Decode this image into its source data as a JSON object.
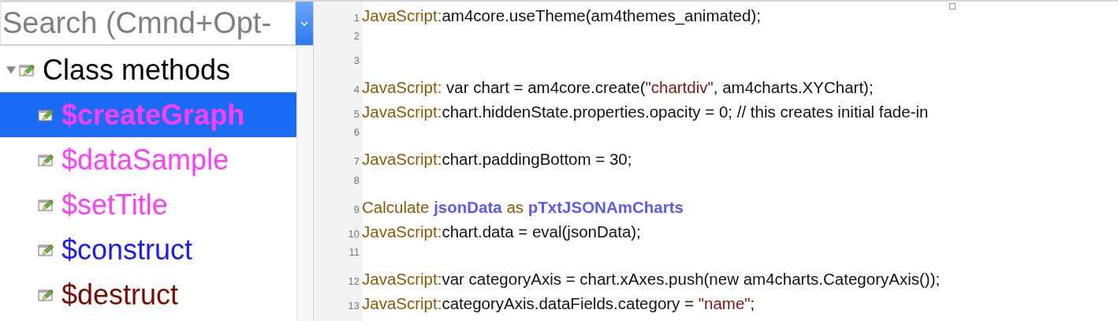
{
  "search": {
    "placeholder": "Search (Cmnd+Opt-"
  },
  "tree": [
    {
      "label": "Class methods",
      "expanded": true,
      "selected": false,
      "color": "#000000",
      "children": [
        {
          "label": "$createGraph",
          "selected": true,
          "color": "#ff3dfc"
        },
        {
          "label": "$dataSample",
          "selected": false,
          "color": "#ff3dfc"
        },
        {
          "label": "$setTitle",
          "selected": false,
          "color": "#ff3dfc"
        },
        {
          "label": "$construct",
          "selected": false,
          "color": "#1a1aff"
        },
        {
          "label": "$destruct",
          "selected": false,
          "color": "#7a0a00"
        }
      ]
    }
  ],
  "code_lines": [
    {
      "number": "1",
      "segments": [
        {
          "kind": "keyword",
          "text": "JavaScript:"
        },
        {
          "kind": "plain",
          "text": "am4core.useTheme(am4themes_animated);"
        }
      ]
    },
    {
      "number": "2"
    },
    {
      "number": "3"
    },
    {
      "number": "4",
      "segments": [
        {
          "kind": "keyword",
          "text": "JavaScript:"
        },
        {
          "kind": "plain",
          "text": " var chart = am4core.create("
        },
        {
          "kind": "string",
          "text": "\"chartdiv\""
        },
        {
          "kind": "plain",
          "text": ", am4charts.XYChart);"
        }
      ]
    },
    {
      "number": "5",
      "segments": [
        {
          "kind": "keyword",
          "text": "JavaScript:"
        },
        {
          "kind": "plain",
          "text": "chart.hiddenState.properties.opacity = 0; // this creates initial fade-in"
        }
      ]
    },
    {
      "number": "6"
    },
    {
      "number": "7",
      "segments": [
        {
          "kind": "keyword",
          "text": "JavaScript:"
        },
        {
          "kind": "plain",
          "text": "chart.paddingBottom = 30;"
        }
      ]
    },
    {
      "number": "8"
    },
    {
      "number": "9",
      "segments": [
        {
          "kind": "keyword",
          "text": "Calculate "
        },
        {
          "kind": "variable",
          "text": "jsonData"
        },
        {
          "kind": "keyword",
          "text": " as "
        },
        {
          "kind": "variable",
          "text": "pTxtJSONAmCharts"
        }
      ]
    },
    {
      "number": "10",
      "segments": [
        {
          "kind": "keyword",
          "text": "JavaScript:"
        },
        {
          "kind": "plain",
          "text": "chart.data = eval(jsonData);"
        }
      ]
    },
    {
      "number": "11"
    },
    {
      "number": "12",
      "segments": [
        {
          "kind": "keyword",
          "text": "JavaScript:"
        },
        {
          "kind": "plain",
          "text": "var categoryAxis = chart.xAxes.push(new am4charts.CategoryAxis());"
        }
      ]
    },
    {
      "number": "13",
      "segments": [
        {
          "kind": "keyword",
          "text": "JavaScript:"
        },
        {
          "kind": "plain",
          "text": "categoryAxis.dataFields.category = "
        },
        {
          "kind": "string",
          "text": "\"name\""
        },
        {
          "kind": "plain",
          "text": ";"
        }
      ]
    }
  ]
}
